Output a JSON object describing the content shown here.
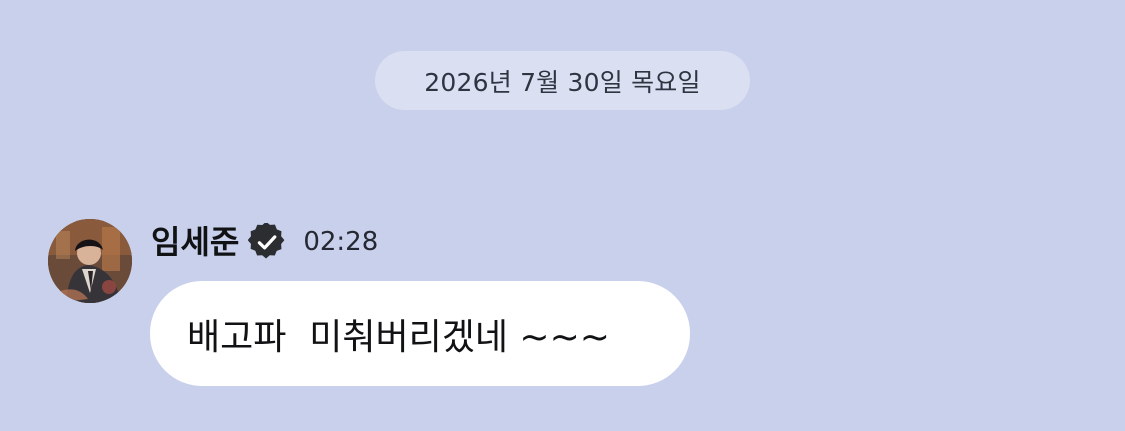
{
  "date_divider": "2026년 7월 30일 목요일",
  "message": {
    "sender": "임세준",
    "time": "02:28",
    "text": "배고파  미춰버리겠네 ~~~",
    "avatar_icon": "profile-photo",
    "verified_icon": "verified-badge-icon"
  },
  "colors": {
    "background": "#c9d0eb",
    "date_pill": "#dadff2",
    "bubble": "#ffffff",
    "badge": "#2c2d31"
  }
}
